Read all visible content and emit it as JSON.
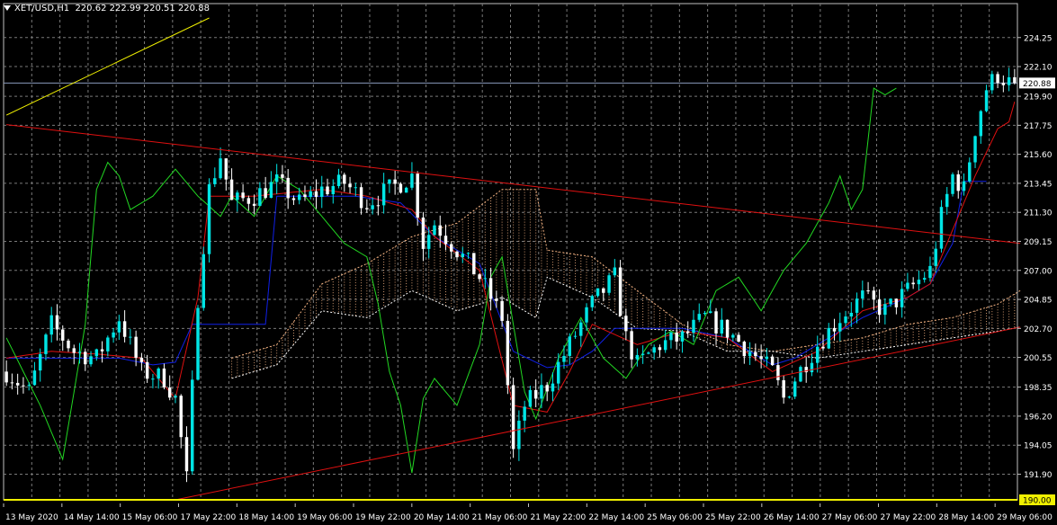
{
  "header": {
    "symbol": "XET/USD,H1",
    "ohlc": "220.62 222.99 220.51 220.88"
  },
  "colors": {
    "background": "#000000",
    "grid": "#7a7a7a",
    "bull": "#00e5e5",
    "bear": "#ffffff",
    "axis_text": "#ffffff",
    "tenkan": "#e01010",
    "kijun": "#1020e8",
    "chikou": "#22d822",
    "cloud_a": "#f0b080",
    "cloud_b": "#ffffff",
    "trendline": "#e01010",
    "yellow_line": "#f0f000",
    "current_price_line": "#8899bb",
    "support_label_bg": "#f0f000"
  },
  "icons": [
    "dropdown-triangle-icon"
  ],
  "chart_data": {
    "type": "candlestick",
    "symbol": "XET/USD",
    "timeframe": "H1",
    "ylim": [
      190.0,
      225.7
    ],
    "y_ticks": [
      "224.25",
      "222.10",
      "219.90",
      "217.75",
      "215.60",
      "213.45",
      "211.30",
      "209.15",
      "207.00",
      "204.85",
      "202.70",
      "200.55",
      "198.35",
      "196.20",
      "194.05",
      "191.90"
    ],
    "x_ticks": [
      "13 May 2020",
      "14 May 14:00",
      "15 May 06:00",
      "17 May 22:00",
      "18 May 14:00",
      "19 May 06:00",
      "19 May 22:00",
      "20 May 14:00",
      "21 May 06:00",
      "21 May 22:00",
      "22 May 14:00",
      "25 May 06:00",
      "25 May 22:00",
      "26 May 14:00",
      "27 May 06:00",
      "27 May 22:00",
      "28 May 14:00",
      "29 May 06:00"
    ],
    "current_price": 220.88,
    "current_price_label": "220.88",
    "support_level": 190.0,
    "support_label": "190.00",
    "grid": true,
    "bar_count": 180,
    "price_path": [
      [
        0,
        199.5
      ],
      [
        4,
        198.0
      ],
      [
        8,
        203.0
      ],
      [
        12,
        201.0
      ],
      [
        16,
        200.5
      ],
      [
        20,
        203.5
      ],
      [
        24,
        199.5
      ],
      [
        28,
        199.0
      ],
      [
        30,
        197.5
      ],
      [
        32,
        191.5
      ],
      [
        34,
        205.0
      ],
      [
        36,
        213.0
      ],
      [
        38,
        215.5
      ],
      [
        40,
        212.0
      ],
      [
        44,
        212.5
      ],
      [
        48,
        213.5
      ],
      [
        52,
        212.0
      ],
      [
        56,
        213.0
      ],
      [
        60,
        213.5
      ],
      [
        64,
        212.0
      ],
      [
        68,
        213.0
      ],
      [
        72,
        214.0
      ],
      [
        74,
        209.0
      ],
      [
        76,
        210.5
      ],
      [
        80,
        208.5
      ],
      [
        84,
        206.5
      ],
      [
        88,
        203.5
      ],
      [
        90,
        193.5
      ],
      [
        92,
        197.0
      ],
      [
        96,
        198.5
      ],
      [
        100,
        201.5
      ],
      [
        104,
        204.5
      ],
      [
        108,
        206.5
      ],
      [
        110,
        202.0
      ],
      [
        112,
        200.0
      ],
      [
        116,
        201.5
      ],
      [
        120,
        202.0
      ],
      [
        124,
        203.5
      ],
      [
        128,
        202.5
      ],
      [
        132,
        201.0
      ],
      [
        136,
        199.5
      ],
      [
        138,
        197.5
      ],
      [
        140,
        199.0
      ],
      [
        144,
        201.5
      ],
      [
        148,
        203.5
      ],
      [
        152,
        205.0
      ],
      [
        156,
        204.0
      ],
      [
        160,
        205.5
      ],
      [
        164,
        207.0
      ],
      [
        166,
        211.0
      ],
      [
        168,
        214.0
      ],
      [
        170,
        213.0
      ],
      [
        172,
        217.5
      ],
      [
        174,
        220.5
      ],
      [
        176,
        221.5
      ],
      [
        178,
        220.9
      ],
      [
        179,
        220.88
      ]
    ],
    "tenkan_path": [
      [
        0,
        200.5
      ],
      [
        8,
        201.0
      ],
      [
        16,
        200.8
      ],
      [
        24,
        200.5
      ],
      [
        30,
        197.5
      ],
      [
        34,
        205.0
      ],
      [
        36,
        212.5
      ],
      [
        44,
        212.5
      ],
      [
        56,
        213.0
      ],
      [
        64,
        212.5
      ],
      [
        72,
        211.5
      ],
      [
        76,
        209.5
      ],
      [
        84,
        207.0
      ],
      [
        90,
        197.0
      ],
      [
        96,
        196.5
      ],
      [
        100,
        199.5
      ],
      [
        104,
        203.0
      ],
      [
        112,
        201.5
      ],
      [
        120,
        202.5
      ],
      [
        128,
        202.0
      ],
      [
        136,
        199.5
      ],
      [
        144,
        201.0
      ],
      [
        152,
        204.0
      ],
      [
        160,
        205.0
      ],
      [
        164,
        206.0
      ],
      [
        168,
        210.0
      ],
      [
        172,
        214.0
      ],
      [
        176,
        217.5
      ],
      [
        178,
        218.0
      ],
      [
        179,
        219.5
      ]
    ],
    "kijun_path": [
      [
        0,
        200.5
      ],
      [
        10,
        200.5
      ],
      [
        20,
        200.5
      ],
      [
        26,
        200.0
      ],
      [
        30,
        200.2
      ],
      [
        33,
        203.0
      ],
      [
        36,
        203.0
      ],
      [
        46,
        203.0
      ],
      [
        48,
        212.5
      ],
      [
        62,
        212.5
      ],
      [
        70,
        212.0
      ],
      [
        76,
        209.5
      ],
      [
        84,
        207.5
      ],
      [
        90,
        201.0
      ],
      [
        96,
        199.8
      ],
      [
        100,
        200.0
      ],
      [
        104,
        201.0
      ],
      [
        108,
        202.7
      ],
      [
        120,
        202.7
      ],
      [
        128,
        202.0
      ],
      [
        136,
        200.0
      ],
      [
        140,
        200.5
      ],
      [
        144,
        201.5
      ],
      [
        152,
        203.5
      ],
      [
        160,
        205.0
      ],
      [
        164,
        206.0
      ],
      [
        168,
        209.0
      ],
      [
        170,
        213.6
      ],
      [
        174,
        213.6
      ]
    ],
    "chikou_path": [
      [
        0,
        202.0
      ],
      [
        6,
        197.0
      ],
      [
        10,
        193.0
      ],
      [
        14,
        203.0
      ],
      [
        16,
        213.0
      ],
      [
        18,
        215.0
      ],
      [
        20,
        214.0
      ],
      [
        22,
        211.5
      ],
      [
        26,
        212.5
      ],
      [
        30,
        214.5
      ],
      [
        34,
        212.5
      ],
      [
        38,
        211.0
      ],
      [
        40,
        212.5
      ],
      [
        44,
        211.0
      ],
      [
        48,
        214.0
      ],
      [
        52,
        213.0
      ],
      [
        56,
        211.0
      ],
      [
        60,
        209.0
      ],
      [
        64,
        208.0
      ],
      [
        66,
        204.5
      ],
      [
        68,
        199.5
      ],
      [
        70,
        197.0
      ],
      [
        72,
        192.0
      ],
      [
        74,
        197.5
      ],
      [
        76,
        199.0
      ],
      [
        80,
        197.0
      ],
      [
        84,
        201.5
      ],
      [
        86,
        206.5
      ],
      [
        88,
        208.0
      ],
      [
        90,
        203.0
      ],
      [
        92,
        198.0
      ],
      [
        94,
        196.0
      ],
      [
        98,
        200.5
      ],
      [
        102,
        203.5
      ],
      [
        106,
        200.5
      ],
      [
        110,
        199.0
      ],
      [
        114,
        201.5
      ],
      [
        118,
        202.5
      ],
      [
        122,
        201.5
      ],
      [
        126,
        205.5
      ],
      [
        130,
        206.5
      ],
      [
        134,
        204.0
      ],
      [
        138,
        207.0
      ],
      [
        142,
        209.0
      ],
      [
        146,
        212.0
      ],
      [
        148,
        214.0
      ],
      [
        150,
        211.5
      ],
      [
        152,
        213.0
      ],
      [
        154,
        220.5
      ],
      [
        156,
        220.0
      ],
      [
        158,
        220.5
      ]
    ],
    "cloud_span_a": [
      [
        40,
        200.5
      ],
      [
        48,
        201.5
      ],
      [
        56,
        206.0
      ],
      [
        64,
        207.5
      ],
      [
        72,
        209.5
      ],
      [
        80,
        210.5
      ],
      [
        88,
        213.0
      ],
      [
        94,
        213.0
      ],
      [
        96,
        208.5
      ],
      [
        104,
        208.0
      ],
      [
        112,
        205.5
      ],
      [
        120,
        203.0
      ],
      [
        128,
        201.5
      ],
      [
        136,
        201.0
      ],
      [
        144,
        201.5
      ],
      [
        152,
        202.0
      ],
      [
        160,
        203.0
      ],
      [
        168,
        203.5
      ],
      [
        176,
        204.5
      ],
      [
        180,
        205.5
      ]
    ],
    "cloud_span_b": [
      [
        40,
        199.0
      ],
      [
        48,
        200.0
      ],
      [
        56,
        204.0
      ],
      [
        64,
        203.5
      ],
      [
        72,
        205.5
      ],
      [
        80,
        204.0
      ],
      [
        88,
        205.0
      ],
      [
        94,
        203.5
      ],
      [
        96,
        206.5
      ],
      [
        104,
        205.0
      ],
      [
        112,
        202.7
      ],
      [
        120,
        202.5
      ],
      [
        128,
        201.0
      ],
      [
        136,
        201.0
      ],
      [
        144,
        200.5
      ],
      [
        152,
        201.0
      ],
      [
        160,
        201.5
      ],
      [
        168,
        202.0
      ],
      [
        176,
        202.5
      ],
      [
        180,
        202.8
      ]
    ],
    "trendlines": [
      {
        "name": "upper-trendline",
        "x0": 0,
        "y0": 217.8,
        "x1": 180,
        "y1": 209.0
      },
      {
        "name": "lower-trendline",
        "x0": 30,
        "y0": 190.0,
        "x1": 180,
        "y1": 202.8
      },
      {
        "name": "yellow-trendline",
        "x0": 0,
        "y0": 218.5,
        "x1": 36,
        "y1": 225.7
      }
    ]
  }
}
